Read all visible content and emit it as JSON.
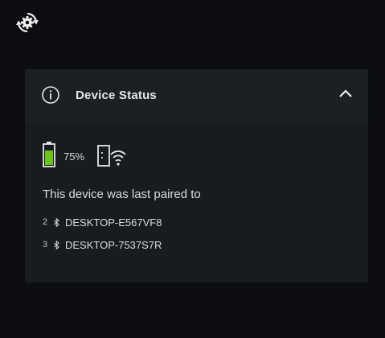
{
  "header": {
    "title": "Device Status"
  },
  "status": {
    "battery_percent_text": "75%",
    "battery_level": 0.75
  },
  "paired": {
    "intro": "This device was last paired to",
    "items": [
      {
        "index": "2",
        "name": "DESKTOP-E567VF8"
      },
      {
        "index": "3",
        "name": "DESKTOP-7537S7R"
      }
    ]
  },
  "colors": {
    "battery_fill": "#6ec318",
    "panel_bg": "#181c20",
    "header_bg": "#1c2024",
    "page_bg": "#0b0d10",
    "text": "#e6e6e6"
  },
  "icons": {
    "settings_sync": "settings-sync-icon",
    "info": "info-icon",
    "collapse": "chevron-up-icon",
    "battery": "battery-icon",
    "device_wifi": "device-wifi-icon",
    "bluetooth": "bluetooth-icon"
  }
}
